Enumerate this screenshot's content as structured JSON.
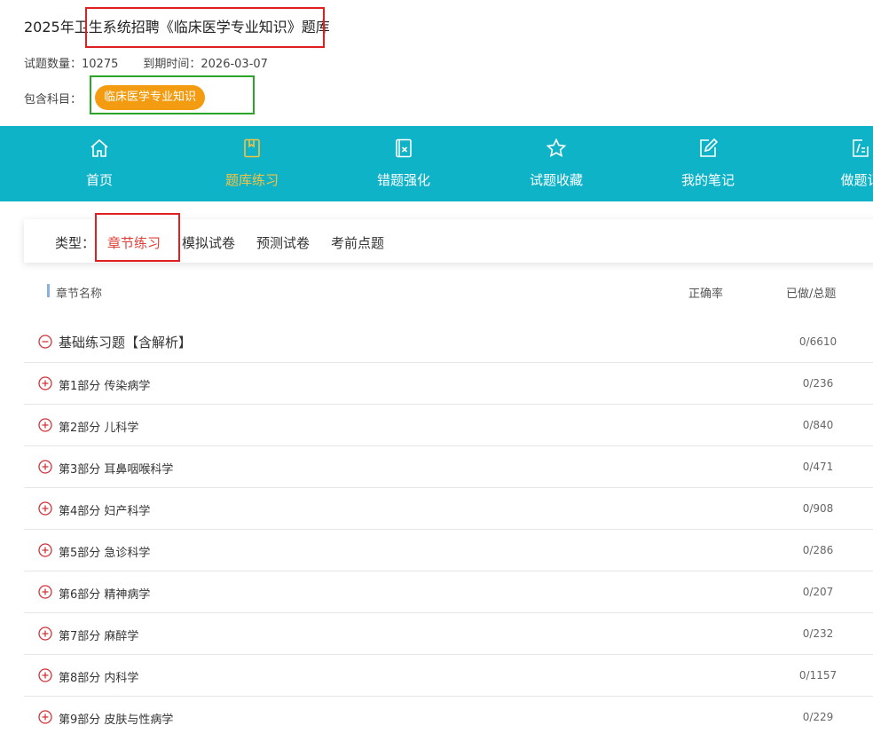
{
  "header": {
    "title": "2025年卫生系统招聘《临床医学专业知识》题库",
    "question_count_label": "试题数量：",
    "question_count": "10275",
    "expiry_label": "到期时间：",
    "expiry_date": "2026-03-07",
    "subjects_label": "包含科目：",
    "subject_pill": "临床医学专业知识"
  },
  "colors": {
    "nav_bg": "#0eb3c8",
    "nav_active": "#f5c242",
    "pill_bg": "#f39c12",
    "active_type": "#e0403a",
    "highlight_red": "#e02020",
    "highlight_green": "#2aa52a"
  },
  "nav": [
    {
      "label": "首页",
      "icon": "home-icon"
    },
    {
      "label": "题库练习",
      "icon": "book-icon",
      "active": true
    },
    {
      "label": "错题强化",
      "icon": "error-doc-icon"
    },
    {
      "label": "试题收藏",
      "icon": "star-icon"
    },
    {
      "label": "我的笔记",
      "icon": "note-edit-icon"
    },
    {
      "label": "做题记",
      "icon": "record-icon"
    }
  ],
  "types": {
    "label": "类型：",
    "options": [
      "章节练习",
      "模拟试卷",
      "预测试卷",
      "考前点题"
    ],
    "selected": "章节练习"
  },
  "list": {
    "col_name": "章节名称",
    "col_accuracy": "正确率",
    "col_progress": "已做/总题",
    "root": {
      "name": "基础练习题【含解析】",
      "count": "0/6610",
      "icon": "minus-circle-icon"
    },
    "rows": [
      {
        "name": "第1部分 传染病学",
        "count": "0/236"
      },
      {
        "name": "第2部分 儿科学",
        "count": "0/840"
      },
      {
        "name": "第3部分 耳鼻咽喉科学",
        "count": "0/471"
      },
      {
        "name": "第4部分 妇产科学",
        "count": "0/908"
      },
      {
        "name": "第5部分 急诊科学",
        "count": "0/286"
      },
      {
        "name": "第6部分 精神病学",
        "count": "0/207"
      },
      {
        "name": "第7部分 麻醉学",
        "count": "0/232"
      },
      {
        "name": "第8部分 内科学",
        "count": "0/1157"
      },
      {
        "name": "第9部分 皮肤与性病学",
        "count": "0/229"
      }
    ]
  }
}
